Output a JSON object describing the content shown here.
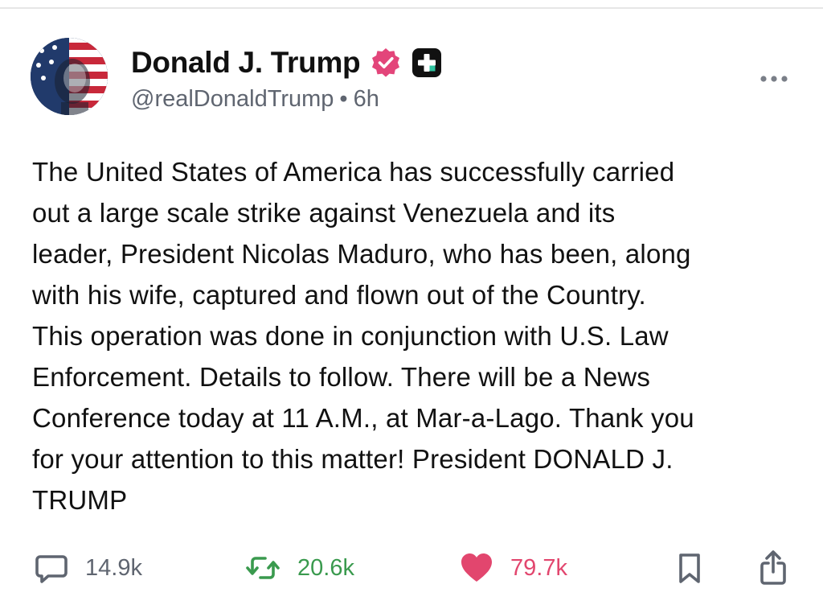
{
  "post": {
    "author": {
      "display_name": "Donald J. Trump",
      "handle": "@realDonaldTrump",
      "separator": "•",
      "time_ago": "6h",
      "verified_icon": "verified-badge-icon",
      "plus_icon": "plus-badge-icon"
    },
    "body_lines": [
      "The United States of America has successfully carried",
      "out a large scale strike against Venezuela and its",
      "leader, President Nicolas Maduro, who has been, along",
      "with his wife, captured and flown out of the Country.",
      "This operation was done in conjunction with U.S. Law",
      "Enforcement. Details to follow. There will be a News",
      "Conference today at 11 A.M., at Mar-a-Lago. Thank you",
      "for your attention to this matter! President DONALD J.",
      "TRUMP"
    ],
    "actions": {
      "replies": "14.9k",
      "reposts": "20.6k",
      "likes": "79.7k"
    }
  },
  "colors": {
    "verified": "#e3457a",
    "repost": "#3a9a4e",
    "like": "#e2466e",
    "muted": "#5f6570",
    "text": "#111111"
  }
}
